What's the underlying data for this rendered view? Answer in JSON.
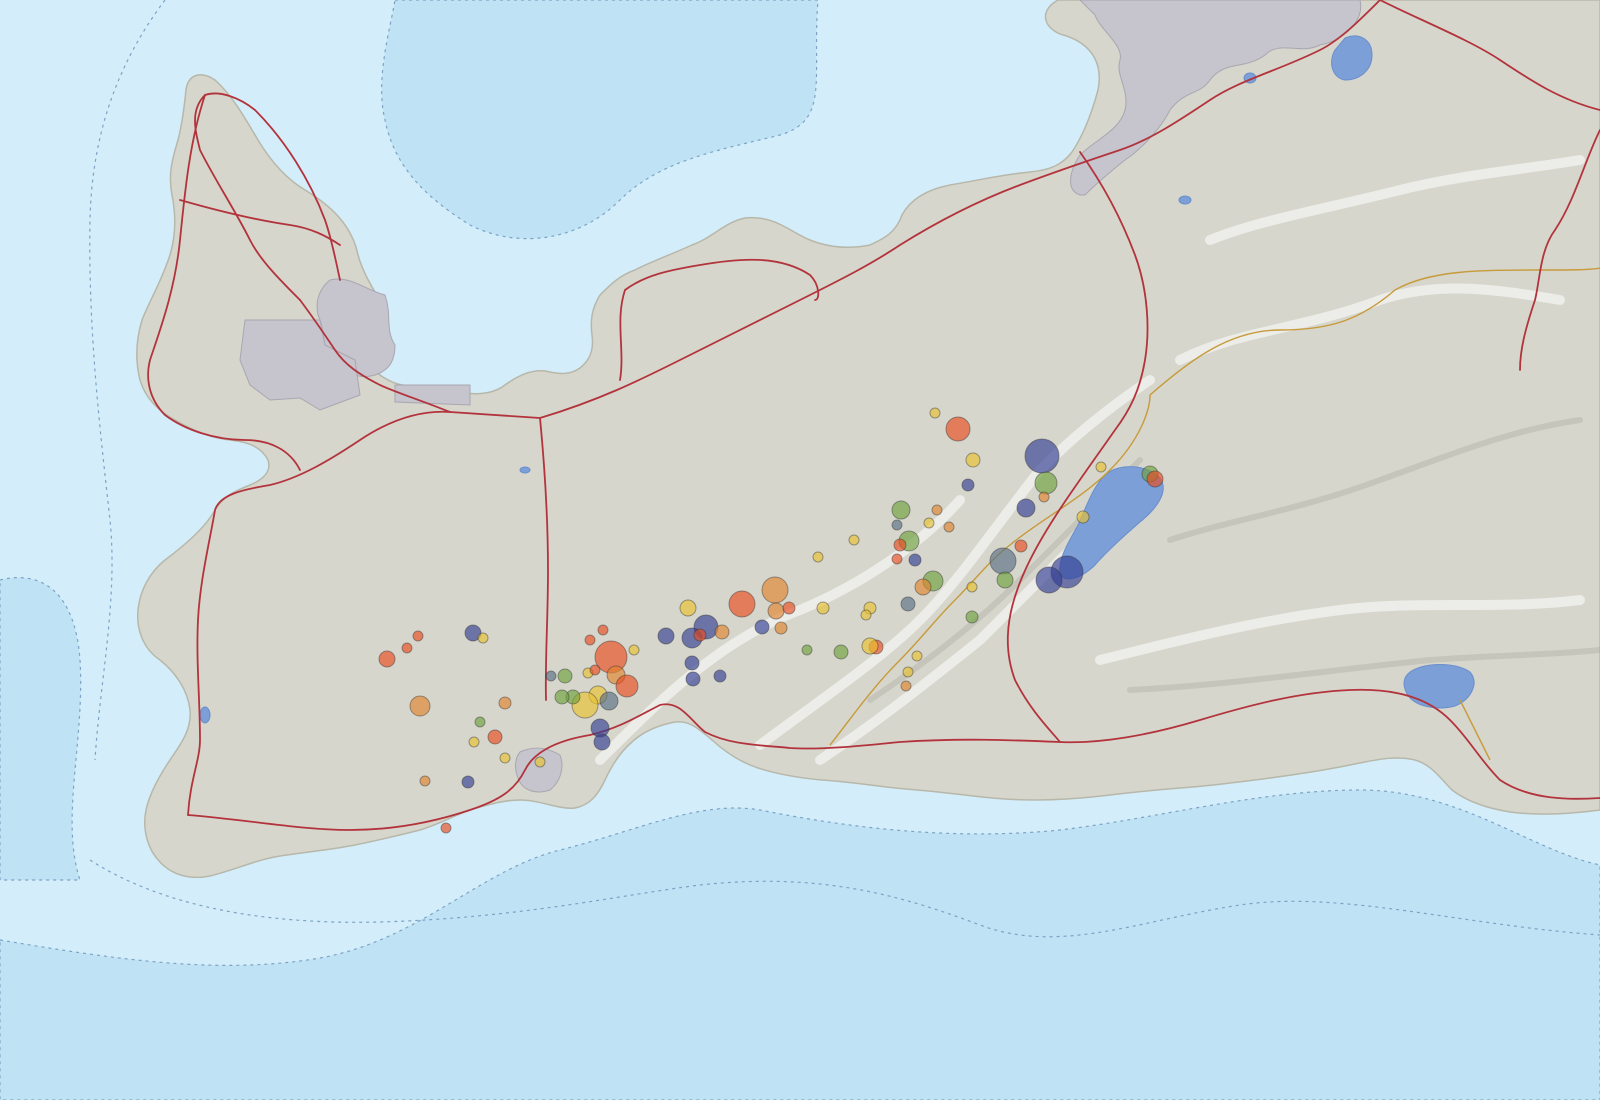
{
  "map": {
    "colors": {
      "sea": "#d3eefa",
      "deep_sea": "#bfe2f5",
      "land": "#d6d6cc",
      "urban": "#c6c4cc",
      "lake": "#7b9fd6",
      "road": "#b3333c",
      "track": "#c79a3a"
    },
    "quake_color_scale": [
      "#e94c1f",
      "#e0822e",
      "#e9c12f",
      "#6ea13c",
      "#596e86",
      "#333d93"
    ]
  }
}
